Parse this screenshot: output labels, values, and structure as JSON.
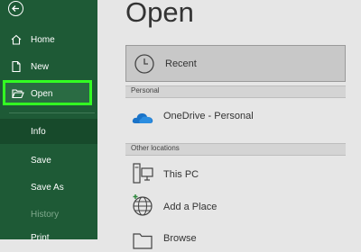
{
  "sidebar": {
    "back_icon": "back-arrow-icon",
    "items": [
      {
        "label": "Home",
        "icon": "home-icon"
      },
      {
        "label": "New",
        "icon": "new-document-icon"
      },
      {
        "label": "Open",
        "icon": "folder-open-icon"
      },
      {
        "label": "Info"
      },
      {
        "label": "Save"
      },
      {
        "label": "Save As"
      },
      {
        "label": "History"
      },
      {
        "label": "Print"
      }
    ],
    "colors": {
      "background": "#1e5a36",
      "highlight": "#33ff22"
    }
  },
  "main": {
    "title": "Open",
    "recent": {
      "label": "Recent",
      "icon": "clock-icon"
    },
    "sections": [
      {
        "header": "Personal",
        "items": [
          {
            "label": "OneDrive - Personal",
            "icon": "onedrive-cloud-icon"
          }
        ]
      },
      {
        "header": "Other locations",
        "items": [
          {
            "label": "This PC",
            "icon": "computer-icon"
          },
          {
            "label": "Add a Place",
            "icon": "globe-add-icon"
          },
          {
            "label": "Browse",
            "icon": "folder-icon"
          }
        ]
      }
    ]
  }
}
